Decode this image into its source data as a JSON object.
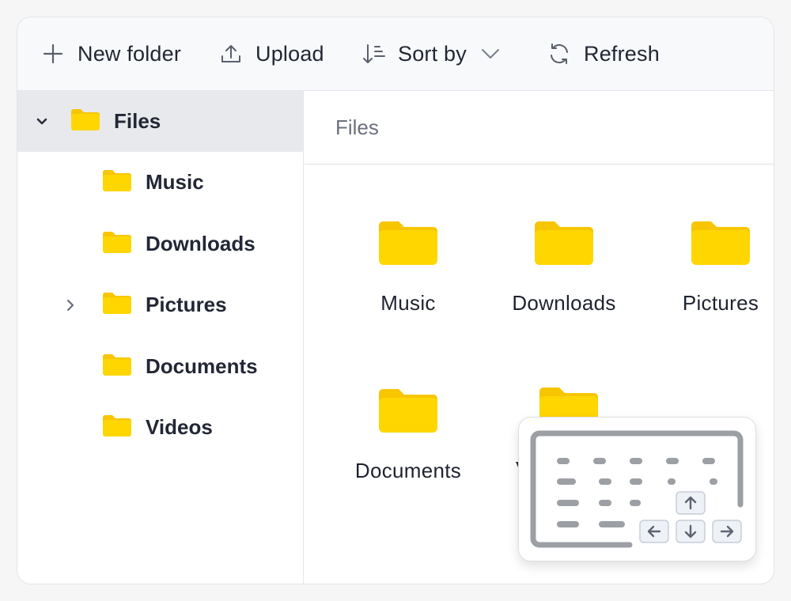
{
  "toolbar": {
    "new_folder_label": "New folder",
    "upload_label": "Upload",
    "sort_label": "Sort by",
    "refresh_label": "Refresh"
  },
  "sidebar": {
    "root": {
      "label": "Files",
      "expanded": true
    },
    "items": [
      {
        "label": "Music",
        "has_children": false
      },
      {
        "label": "Downloads",
        "has_children": false
      },
      {
        "label": "Pictures",
        "has_children": true
      },
      {
        "label": "Documents",
        "has_children": false
      },
      {
        "label": "Videos",
        "has_children": false
      }
    ]
  },
  "main": {
    "breadcrumb": "Files",
    "items": [
      {
        "label": "Music"
      },
      {
        "label": "Downloads"
      },
      {
        "label": "Pictures"
      },
      {
        "label": "Documents"
      },
      {
        "label": "Vi"
      }
    ]
  },
  "icons": {
    "new_folder": "plus-icon",
    "upload": "upload-icon",
    "sort": "sort-icon",
    "sort_dropdown": "chevron-down-icon",
    "refresh": "refresh-icon",
    "folder": "folder-icon",
    "keyboard": "keyboard-icon"
  },
  "colors": {
    "folder": "#FFD600",
    "folder_tab": "#F7C600",
    "selected_row": "#E8E9EC",
    "toolbar_bg": "#F8F9FB"
  }
}
